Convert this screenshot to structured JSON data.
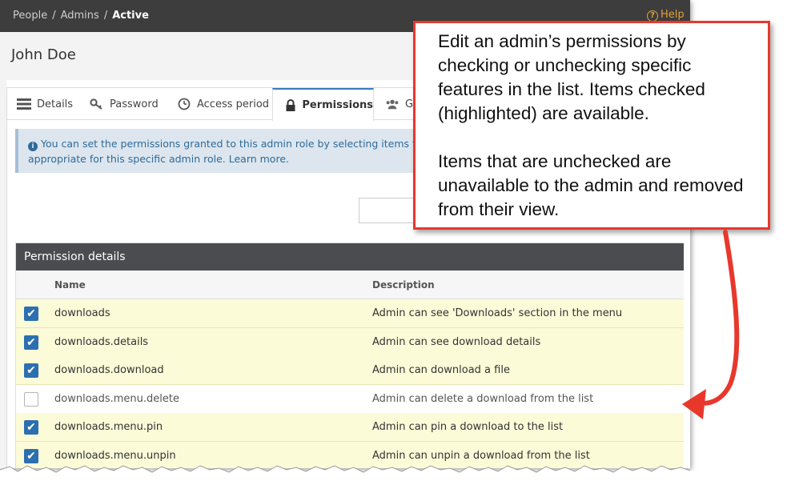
{
  "breadcrumb": {
    "items": [
      "People",
      "Admins"
    ],
    "current": "Active"
  },
  "help_label": "Help",
  "user": {
    "name": "John Doe"
  },
  "tabs": [
    {
      "label": "Details",
      "icon": "details-icon"
    },
    {
      "label": "Password",
      "icon": "key-icon"
    },
    {
      "label": "Access period",
      "icon": "clock-icon"
    },
    {
      "label": "Permissions",
      "icon": "lock-icon",
      "active": true
    },
    {
      "label": "G",
      "icon": "group-icon"
    }
  ],
  "info": {
    "line1": "You can set the permissions granted to this admin role by selecting items fro",
    "line2": "appropriate for this specific admin role. Learn more."
  },
  "table": {
    "title": "Permission details",
    "columns": {
      "name": "Name",
      "description": "Description"
    },
    "rows": [
      {
        "name": "downloads",
        "description": "Admin can see 'Downloads' section in the menu",
        "checked": true
      },
      {
        "name": "downloads.details",
        "description": "Admin can see download details",
        "checked": true
      },
      {
        "name": "downloads.download",
        "description": "Admin can download a file",
        "checked": true
      },
      {
        "name": "downloads.menu.delete",
        "description": "Admin can delete a download from the list",
        "checked": false
      },
      {
        "name": "downloads.menu.pin",
        "description": "Admin can pin a download to the list",
        "checked": true
      },
      {
        "name": "downloads.menu.unpin",
        "description": "Admin can unpin a download from the list",
        "checked": true
      }
    ]
  },
  "callout": {
    "paragraph1": "Edit an admin’s permissions by checking or unchecking specific features in the list. Items checked (highlighted) are available.",
    "paragraph2": "Items that are unchecked are unavailable to the admin and removed from their view."
  },
  "colors": {
    "topbar": "#3d3d3d",
    "accent": "#2c6fb0",
    "highlight_row": "#fbfbd8",
    "callout_border": "#e8382c",
    "help": "#e2a03a"
  }
}
